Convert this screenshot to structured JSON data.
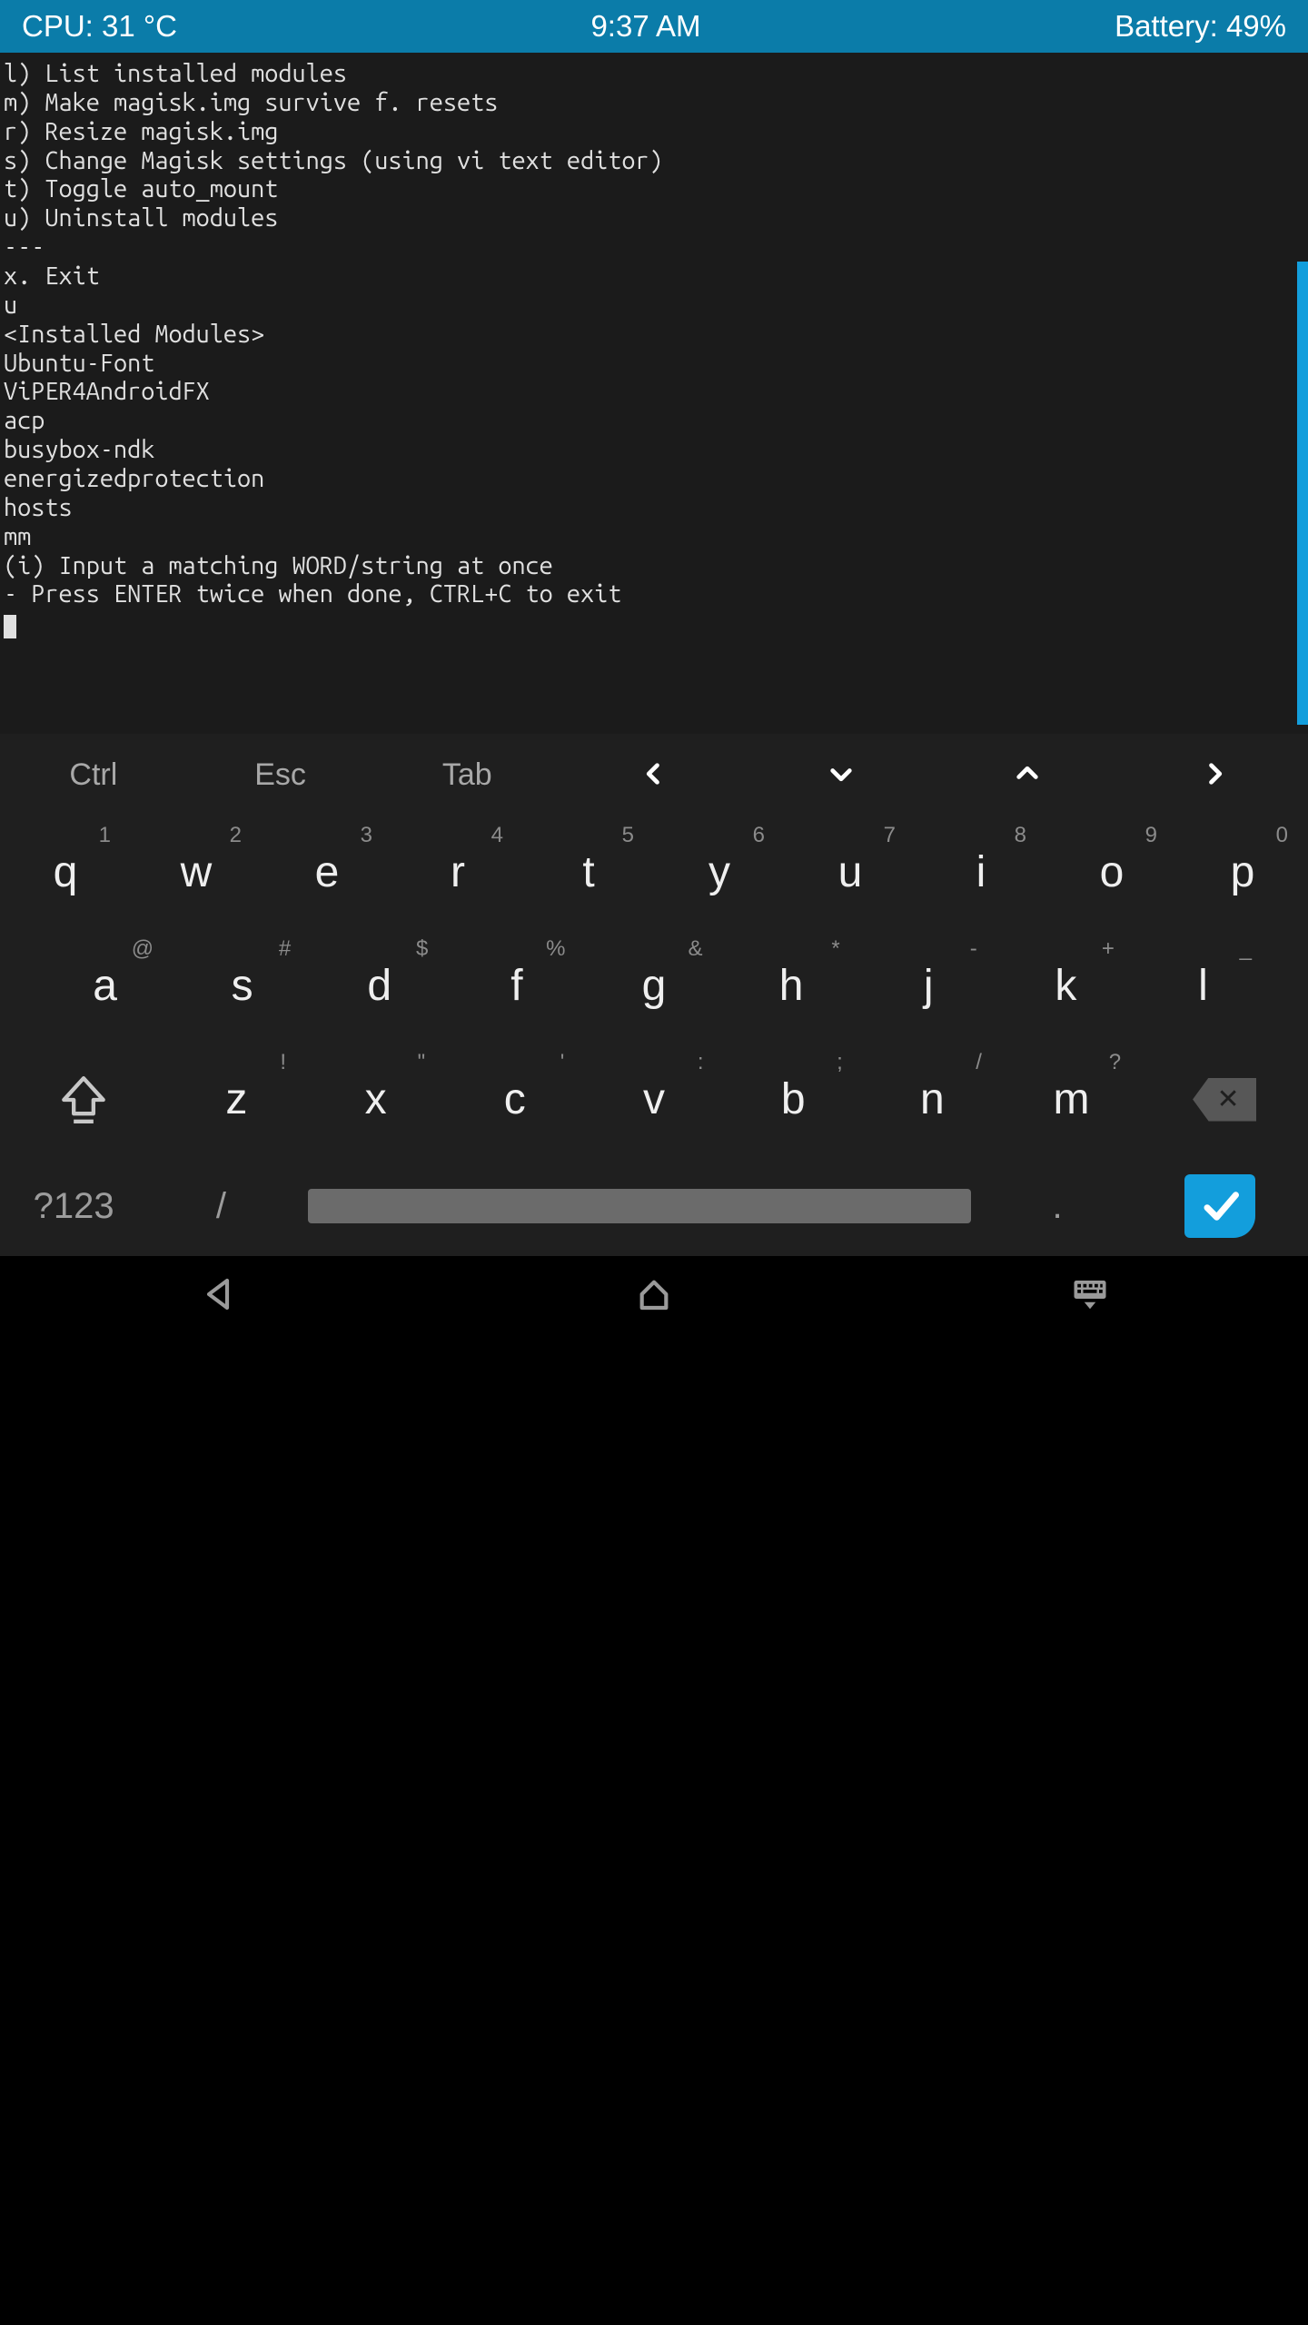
{
  "status": {
    "cpu": "CPU: 31 °C",
    "time": "9:37 AM",
    "battery": "Battery: 49%"
  },
  "terminal": {
    "lines": [
      "l) List installed modules",
      "m) Make magisk.img survive f. resets",
      "r) Resize magisk.img",
      "s) Change Magisk settings (using vi text editor)",
      "t) Toggle auto_mount",
      "u) Uninstall modules",
      "---",
      "x. Exit",
      "u",
      "",
      "<Installed Modules>",
      "",
      "Ubuntu-Font",
      "ViPER4AndroidFX",
      "acp",
      "busybox-ndk",
      "energizedprotection",
      "hosts",
      "mm",
      "",
      "(i) Input a matching WORD/string at once",
      "- Press ENTER twice when done, CTRL+C to exit"
    ]
  },
  "toolbar": {
    "ctrl": "Ctrl",
    "esc": "Esc",
    "tab": "Tab",
    "left": "‹",
    "down": "⌄",
    "up": "⌃",
    "right": "›"
  },
  "keyboard": {
    "row1": [
      {
        "main": "q",
        "alt": "1"
      },
      {
        "main": "w",
        "alt": "2"
      },
      {
        "main": "e",
        "alt": "3"
      },
      {
        "main": "r",
        "alt": "4"
      },
      {
        "main": "t",
        "alt": "5"
      },
      {
        "main": "y",
        "alt": "6"
      },
      {
        "main": "u",
        "alt": "7"
      },
      {
        "main": "i",
        "alt": "8"
      },
      {
        "main": "o",
        "alt": "9"
      },
      {
        "main": "p",
        "alt": "0"
      }
    ],
    "row2": [
      {
        "main": "a",
        "alt": "@"
      },
      {
        "main": "s",
        "alt": "#"
      },
      {
        "main": "d",
        "alt": "$"
      },
      {
        "main": "f",
        "alt": "%"
      },
      {
        "main": "g",
        "alt": "&"
      },
      {
        "main": "h",
        "alt": "*"
      },
      {
        "main": "j",
        "alt": "-"
      },
      {
        "main": "k",
        "alt": "+"
      },
      {
        "main": "l",
        "alt": "_"
      }
    ],
    "row3": [
      {
        "main": "z",
        "alt": "!"
      },
      {
        "main": "x",
        "alt": "\""
      },
      {
        "main": "c",
        "alt": "'"
      },
      {
        "main": "v",
        "alt": ":"
      },
      {
        "main": "b",
        "alt": ";"
      },
      {
        "main": "n",
        "alt": "/"
      },
      {
        "main": "m",
        "alt": "?"
      }
    ],
    "sym": "?123",
    "slash": "/",
    "dot": ".",
    "bksp": "✕"
  }
}
